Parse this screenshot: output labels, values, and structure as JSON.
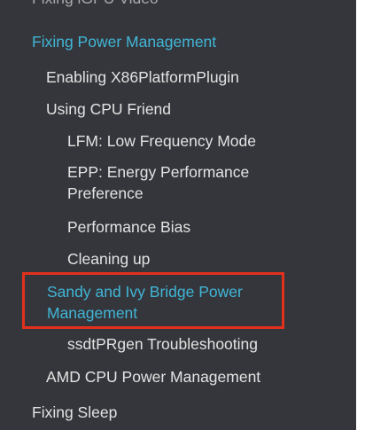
{
  "sidebar": {
    "cut_item": "Fixing iGPU Video",
    "items": [
      {
        "label": "Fixing Power Management",
        "level": 0,
        "active": true
      },
      {
        "label": "Enabling X86PlatformPlugin",
        "level": 1
      },
      {
        "label": "Using CPU Friend",
        "level": 1
      },
      {
        "label": "LFM: Low Frequency Mode",
        "level": 2
      },
      {
        "label": "EPP: Energy Performance Preference",
        "level": 2
      },
      {
        "label": "Performance Bias",
        "level": 2
      },
      {
        "label": "Cleaning up",
        "level": 2
      },
      {
        "label": "Sandy and Ivy Bridge Power Management",
        "level": 1,
        "active": true,
        "highlighted": true
      },
      {
        "label": "ssdtPRgen Troubleshooting",
        "level": 2
      },
      {
        "label": "AMD CPU Power Management",
        "level": 1
      },
      {
        "label": "Fixing Sleep",
        "level": 0
      }
    ]
  },
  "colors": {
    "background": "#34363b",
    "text": "#e3e3e3",
    "active_text": "#41b5d6",
    "highlight_border": "#e2301d"
  }
}
